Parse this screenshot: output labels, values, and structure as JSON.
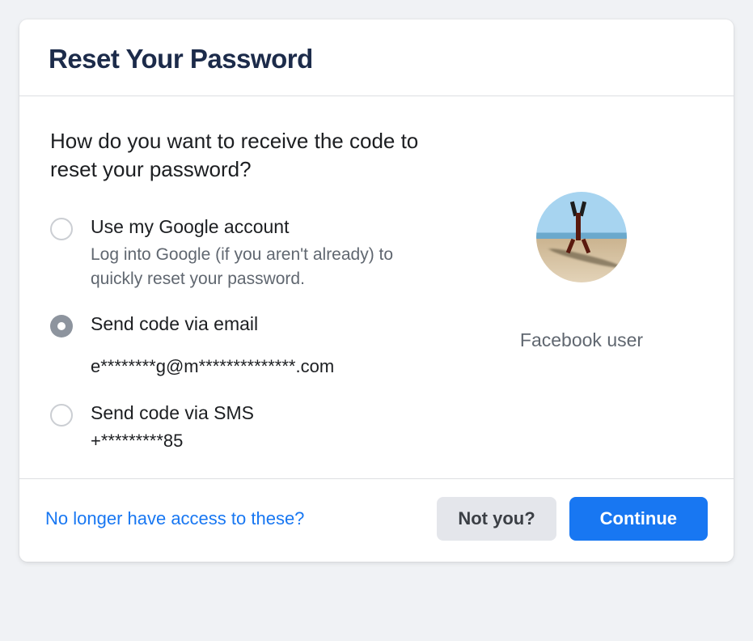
{
  "header": {
    "title": "Reset Your Password"
  },
  "prompt": "How do you want to receive the code to reset your password?",
  "options": [
    {
      "id": "google",
      "title": "Use my Google account",
      "subtitle": "Log into Google (if you aren't already) to quickly reset your password.",
      "selected": false
    },
    {
      "id": "email",
      "title": "Send code via email",
      "subtitle": "e********g@m**************.com",
      "selected": true
    },
    {
      "id": "sms",
      "title": "Send code via SMS",
      "subtitle": "+*********85",
      "selected": false
    }
  ],
  "user": {
    "label": "Facebook user"
  },
  "footer": {
    "no_access_link": "No longer have access to these?",
    "not_you_label": "Not you?",
    "continue_label": "Continue"
  }
}
